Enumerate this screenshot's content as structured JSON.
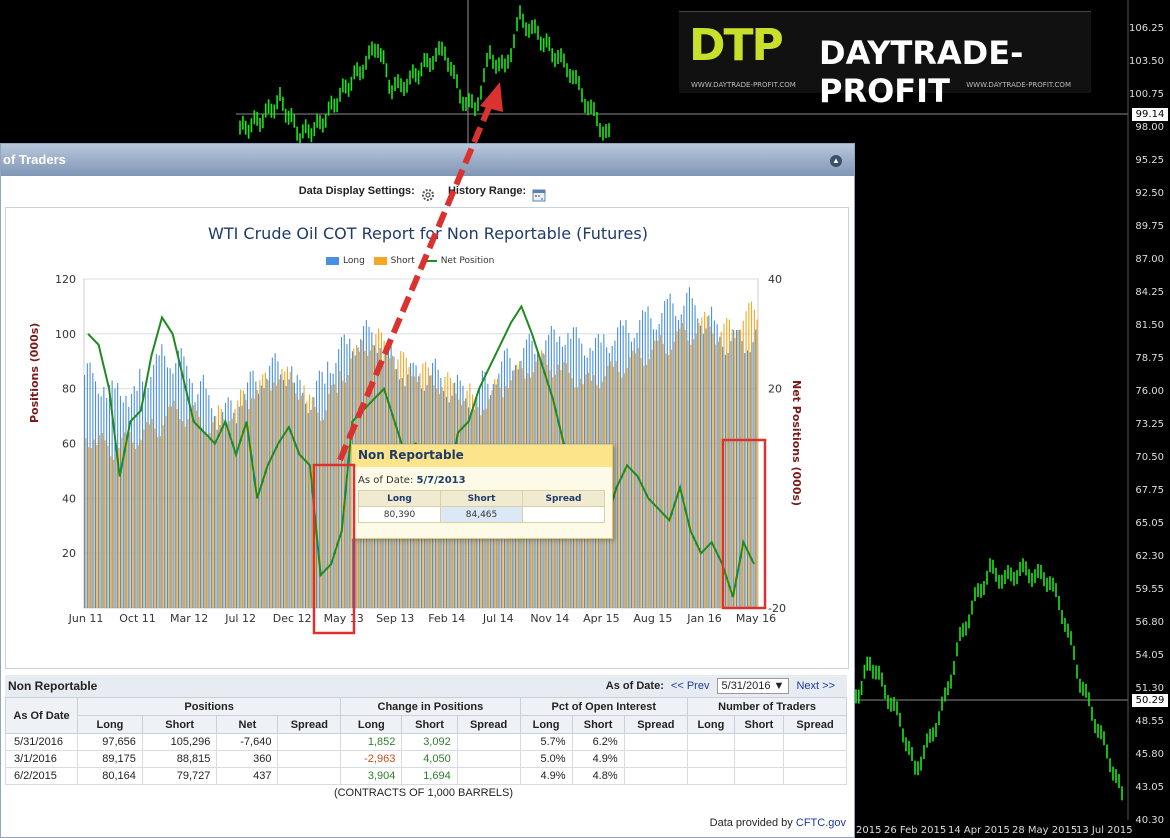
{
  "background": {
    "price_axis": [
      "106.25",
      "103.50",
      "100.75",
      "98.00",
      "95.25",
      "92.50",
      "89.75",
      "87.00",
      "84.25",
      "81.50",
      "78.75",
      "76.00",
      "73.25",
      "70.50",
      "67.75",
      "65.05",
      "62.30",
      "59.55",
      "56.80",
      "54.05",
      "51.30",
      "48.55",
      "45.80",
      "43.05",
      "40.30"
    ],
    "price_tags": [
      "99.14",
      "50.29"
    ],
    "date_labels": [
      "2015",
      "26 Feb 2015",
      "14 Apr 2015",
      "28 May 2015",
      "13 Jul 2015"
    ],
    "colors": {
      "candles": "#16e916",
      "background": "#000000"
    }
  },
  "logo": {
    "mark": "DTP",
    "name": "DAYTRADE-PROFIT",
    "url_left": "WWW.DAYTRADE-PROFIT.COM",
    "url_right": "WWW.DAYTRADE-PROFIT.COM"
  },
  "panel": {
    "title": "of Traders",
    "settings_label": "Data Display Settings:",
    "history_label": "History Range:"
  },
  "chart_data": {
    "type": "bar",
    "title": "WTI Crude Oil COT Report for Non Reportable (Futures)",
    "ylabel": "Positions (000s)",
    "ylabel_right": "Net Positions (000s)",
    "ylim": [
      0,
      120
    ],
    "yticks": [
      20,
      40,
      60,
      80,
      100,
      120
    ],
    "ylim_right": [
      -20,
      40
    ],
    "yticks_right": [
      -20,
      20,
      40
    ],
    "x_ticks": [
      "Jun 11",
      "Oct 11",
      "Mar 12",
      "Jul 12",
      "Dec 12",
      "May 13",
      "Sep 13",
      "Feb 14",
      "Jul 14",
      "Nov 14",
      "Apr 15",
      "Aug 15",
      "Jan 16",
      "May 16"
    ],
    "legend": [
      "Long",
      "Short",
      "Net Position"
    ],
    "colors": {
      "Long": "#4a90e2",
      "Short": "#f5a623",
      "Net Position": "#1f8a1f"
    },
    "series": [
      {
        "name": "Long",
        "values": [
          85,
          82,
          78,
          80,
          76,
          84,
          88,
          92,
          90,
          87,
          80,
          75,
          70,
          72,
          78,
          82,
          85,
          88,
          86,
          80,
          76,
          82,
          90,
          95,
          97,
          100,
          98,
          92,
          88,
          85,
          84,
          86,
          82,
          80,
          78,
          76,
          82,
          86,
          90,
          92,
          95,
          96,
          98,
          100,
          98,
          96,
          95,
          98,
          100,
          102,
          104,
          106,
          108,
          110,
          112,
          108,
          105,
          100,
          97,
          97,
          98
        ]
      },
      {
        "name": "Short",
        "values": [
          62,
          60,
          58,
          60,
          62,
          64,
          66,
          70,
          72,
          70,
          68,
          66,
          70,
          72,
          76,
          80,
          82,
          85,
          84,
          80,
          74,
          72,
          78,
          86,
          92,
          96,
          98,
          95,
          90,
          88,
          86,
          84,
          82,
          80,
          78,
          74,
          76,
          80,
          84,
          86,
          88,
          90,
          88,
          86,
          84,
          82,
          84,
          86,
          88,
          90,
          92,
          94,
          96,
          98,
          100,
          102,
          104,
          100,
          102,
          105,
          108
        ]
      },
      {
        "name": "Net Position",
        "values": [
          30,
          28,
          20,
          4,
          14,
          16,
          26,
          33,
          30,
          22,
          14,
          12,
          10,
          14,
          8,
          14,
          0,
          6,
          10,
          13,
          8,
          6,
          -14,
          -12,
          -6,
          14,
          16,
          18,
          20,
          14,
          8,
          10,
          6,
          4,
          2,
          12,
          14,
          20,
          24,
          28,
          32,
          35,
          30,
          24,
          18,
          10,
          6,
          4,
          0,
          -4,
          2,
          6,
          4,
          0,
          -2,
          -4,
          2,
          -6,
          -10,
          -8,
          -12,
          -18,
          -8,
          -12
        ]
      }
    ],
    "tooltip": {
      "title": "Non Reportable",
      "as_of_label": "As of Date:",
      "as_of": "5/7/2013",
      "cols": [
        "Long",
        "Short",
        "Spread"
      ],
      "values": [
        "80,390",
        "84,465",
        ""
      ]
    }
  },
  "table": {
    "title": "Non Reportable",
    "as_of_label": "As of Date:",
    "prev": "<< Prev",
    "date_value": "5/31/2016",
    "next": "Next >>",
    "group_headers": [
      "As Of Date",
      "Positions",
      "Change in Positions",
      "Pct of Open Interest",
      "Number of Traders"
    ],
    "sub_headers": {
      "positions": [
        "Long",
        "Short",
        "Net",
        "Spread"
      ],
      "change": [
        "Long",
        "Short",
        "Spread"
      ],
      "pct": [
        "Long",
        "Short",
        "Spread"
      ],
      "traders": [
        "Long",
        "Short",
        "Spread"
      ]
    },
    "rows": [
      {
        "date": "5/31/2016",
        "long": "97,656",
        "short": "105,296",
        "net": "-7,640",
        "spread": "",
        "ch_long": "1,852",
        "ch_short": "3,092",
        "ch_spread": "",
        "pct_long": "5.7%",
        "pct_short": "6.2%",
        "pct_spread": "",
        "tr_long": "",
        "tr_short": "",
        "tr_spread": ""
      },
      {
        "date": "3/1/2016",
        "long": "89,175",
        "short": "88,815",
        "net": "360",
        "spread": "",
        "ch_long": "-2,963",
        "ch_short": "4,050",
        "ch_spread": "",
        "pct_long": "5.0%",
        "pct_short": "4.9%",
        "pct_spread": "",
        "tr_long": "",
        "tr_short": "",
        "tr_spread": ""
      },
      {
        "date": "6/2/2015",
        "long": "80,164",
        "short": "79,727",
        "net": "437",
        "spread": "",
        "ch_long": "3,904",
        "ch_short": "1,694",
        "ch_spread": "",
        "pct_long": "4.9%",
        "pct_short": "4.8%",
        "pct_spread": "",
        "tr_long": "",
        "tr_short": "",
        "tr_spread": ""
      }
    ],
    "footer": "(CONTRACTS OF 1,000 BARRELS)",
    "provided_label": "Data provided by",
    "provided_source": "CFTC.gov"
  }
}
